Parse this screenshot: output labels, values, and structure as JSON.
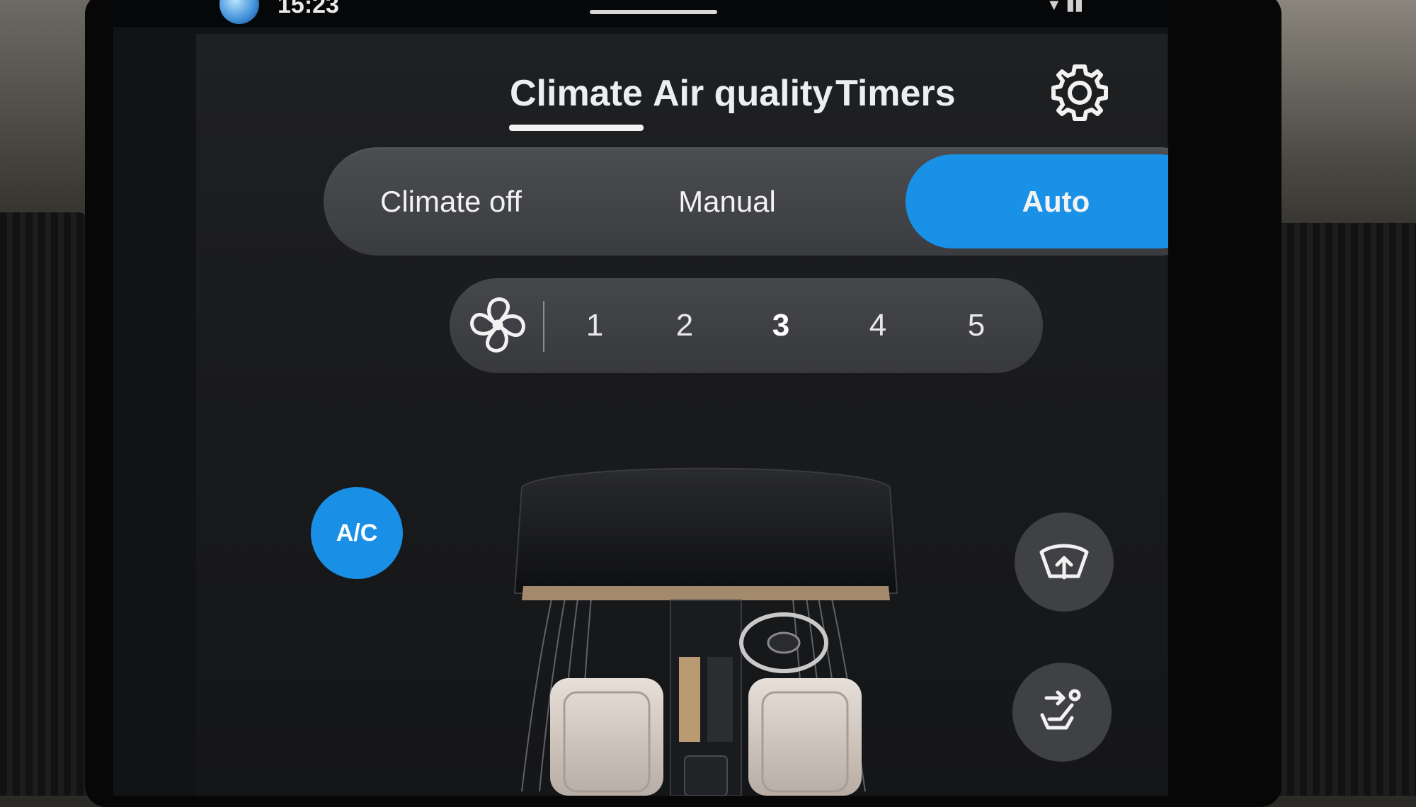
{
  "status_bar": {
    "time": "15:23"
  },
  "tabs": [
    {
      "label": "Climate",
      "active": true
    },
    {
      "label": "Air quality",
      "active": false
    },
    {
      "label": "Timers",
      "active": false
    }
  ],
  "mode": {
    "options": [
      "Climate off",
      "Manual",
      "Auto"
    ],
    "selected": "Auto"
  },
  "fan": {
    "levels": [
      "1",
      "2",
      "3",
      "4",
      "5"
    ],
    "selected": "3"
  },
  "ac": {
    "label": "A/C",
    "on": true
  },
  "icons": {
    "settings": "gear-icon",
    "fan": "fan-icon",
    "windshield": "windshield-defrost-icon",
    "airflow": "seat-airflow-icon"
  },
  "colors": {
    "accent": "#1991e6",
    "panel_bg": "#1f2022",
    "pill_bg": "#45474b"
  }
}
